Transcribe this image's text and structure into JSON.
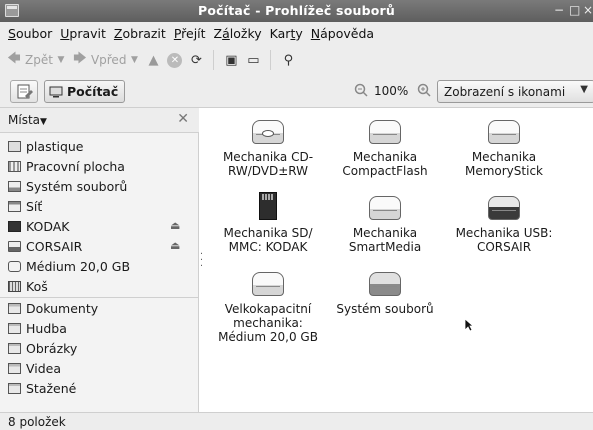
{
  "window": {
    "title": "Počítač - Prohlížeč souborů",
    "controls": [
      "−",
      "□",
      "×"
    ]
  },
  "menu": [
    {
      "pre": "",
      "u": "S",
      "post": "oubor"
    },
    {
      "pre": "",
      "u": "U",
      "post": "pravit"
    },
    {
      "pre": "",
      "u": "Z",
      "post": "obrazit"
    },
    {
      "pre": "",
      "u": "P",
      "post": "řejít"
    },
    {
      "pre": "Z",
      "u": "á",
      "post": "ložky"
    },
    {
      "pre": "Kar",
      "u": "t",
      "post": "y"
    },
    {
      "pre": "",
      "u": "N",
      "post": "ápověda"
    }
  ],
  "toolbar": {
    "back_label": "Zpět",
    "forward_label": "Vpřed"
  },
  "location": {
    "current": "Počítač",
    "zoom": "100%",
    "view_mode": "Zobrazení s ikonami"
  },
  "sidebar": {
    "header": "Místa",
    "groups": [
      [
        {
          "label": "plastique",
          "icon": "home-icon"
        },
        {
          "label": "Pracovní plocha",
          "icon": "desktop-icon"
        },
        {
          "label": "Systém souborů",
          "icon": "filesystem-icon"
        },
        {
          "label": "Síť",
          "icon": "network-icon"
        },
        {
          "label": "KODAK",
          "icon": "sdcard-icon",
          "eject": true
        },
        {
          "label": "CORSAIR",
          "icon": "drive-icon",
          "eject": true
        },
        {
          "label": "Médium 20,0 GB",
          "icon": "media-icon"
        },
        {
          "label": "Koš",
          "icon": "trash-icon"
        }
      ],
      [
        {
          "label": "Dokumenty",
          "icon": "folder-icon"
        },
        {
          "label": "Hudba",
          "icon": "folder-icon"
        },
        {
          "label": "Obrázky",
          "icon": "folder-icon"
        },
        {
          "label": "Videa",
          "icon": "folder-icon"
        },
        {
          "label": "Stažené",
          "icon": "folder-icon"
        }
      ]
    ]
  },
  "items": [
    {
      "lines": [
        "Mechanika CD-",
        "RW/DVD±RW"
      ],
      "icon": "cdrom-icon"
    },
    {
      "lines": [
        "Mechanika",
        "CompactFlash"
      ],
      "icon": "drive-icon"
    },
    {
      "lines": [
        "Mechanika",
        "MemoryStick"
      ],
      "icon": "drive-icon"
    },
    {
      "lines": [
        "Mechanika SD/",
        "MMC: KODAK"
      ],
      "icon": "sdcard-icon"
    },
    {
      "lines": [
        "Mechanika",
        "SmartMedia"
      ],
      "icon": "drive-icon"
    },
    {
      "lines": [
        "Mechanika USB:",
        "CORSAIR"
      ],
      "icon": "usb-drive-icon"
    },
    {
      "lines": [
        "Velkokapacitní",
        "mechanika:",
        "Médium 20,0 GB"
      ],
      "icon": "drive-icon"
    },
    {
      "lines": [
        "Systém souborů"
      ],
      "icon": "harddisk-icon"
    }
  ],
  "status": "8 položek"
}
